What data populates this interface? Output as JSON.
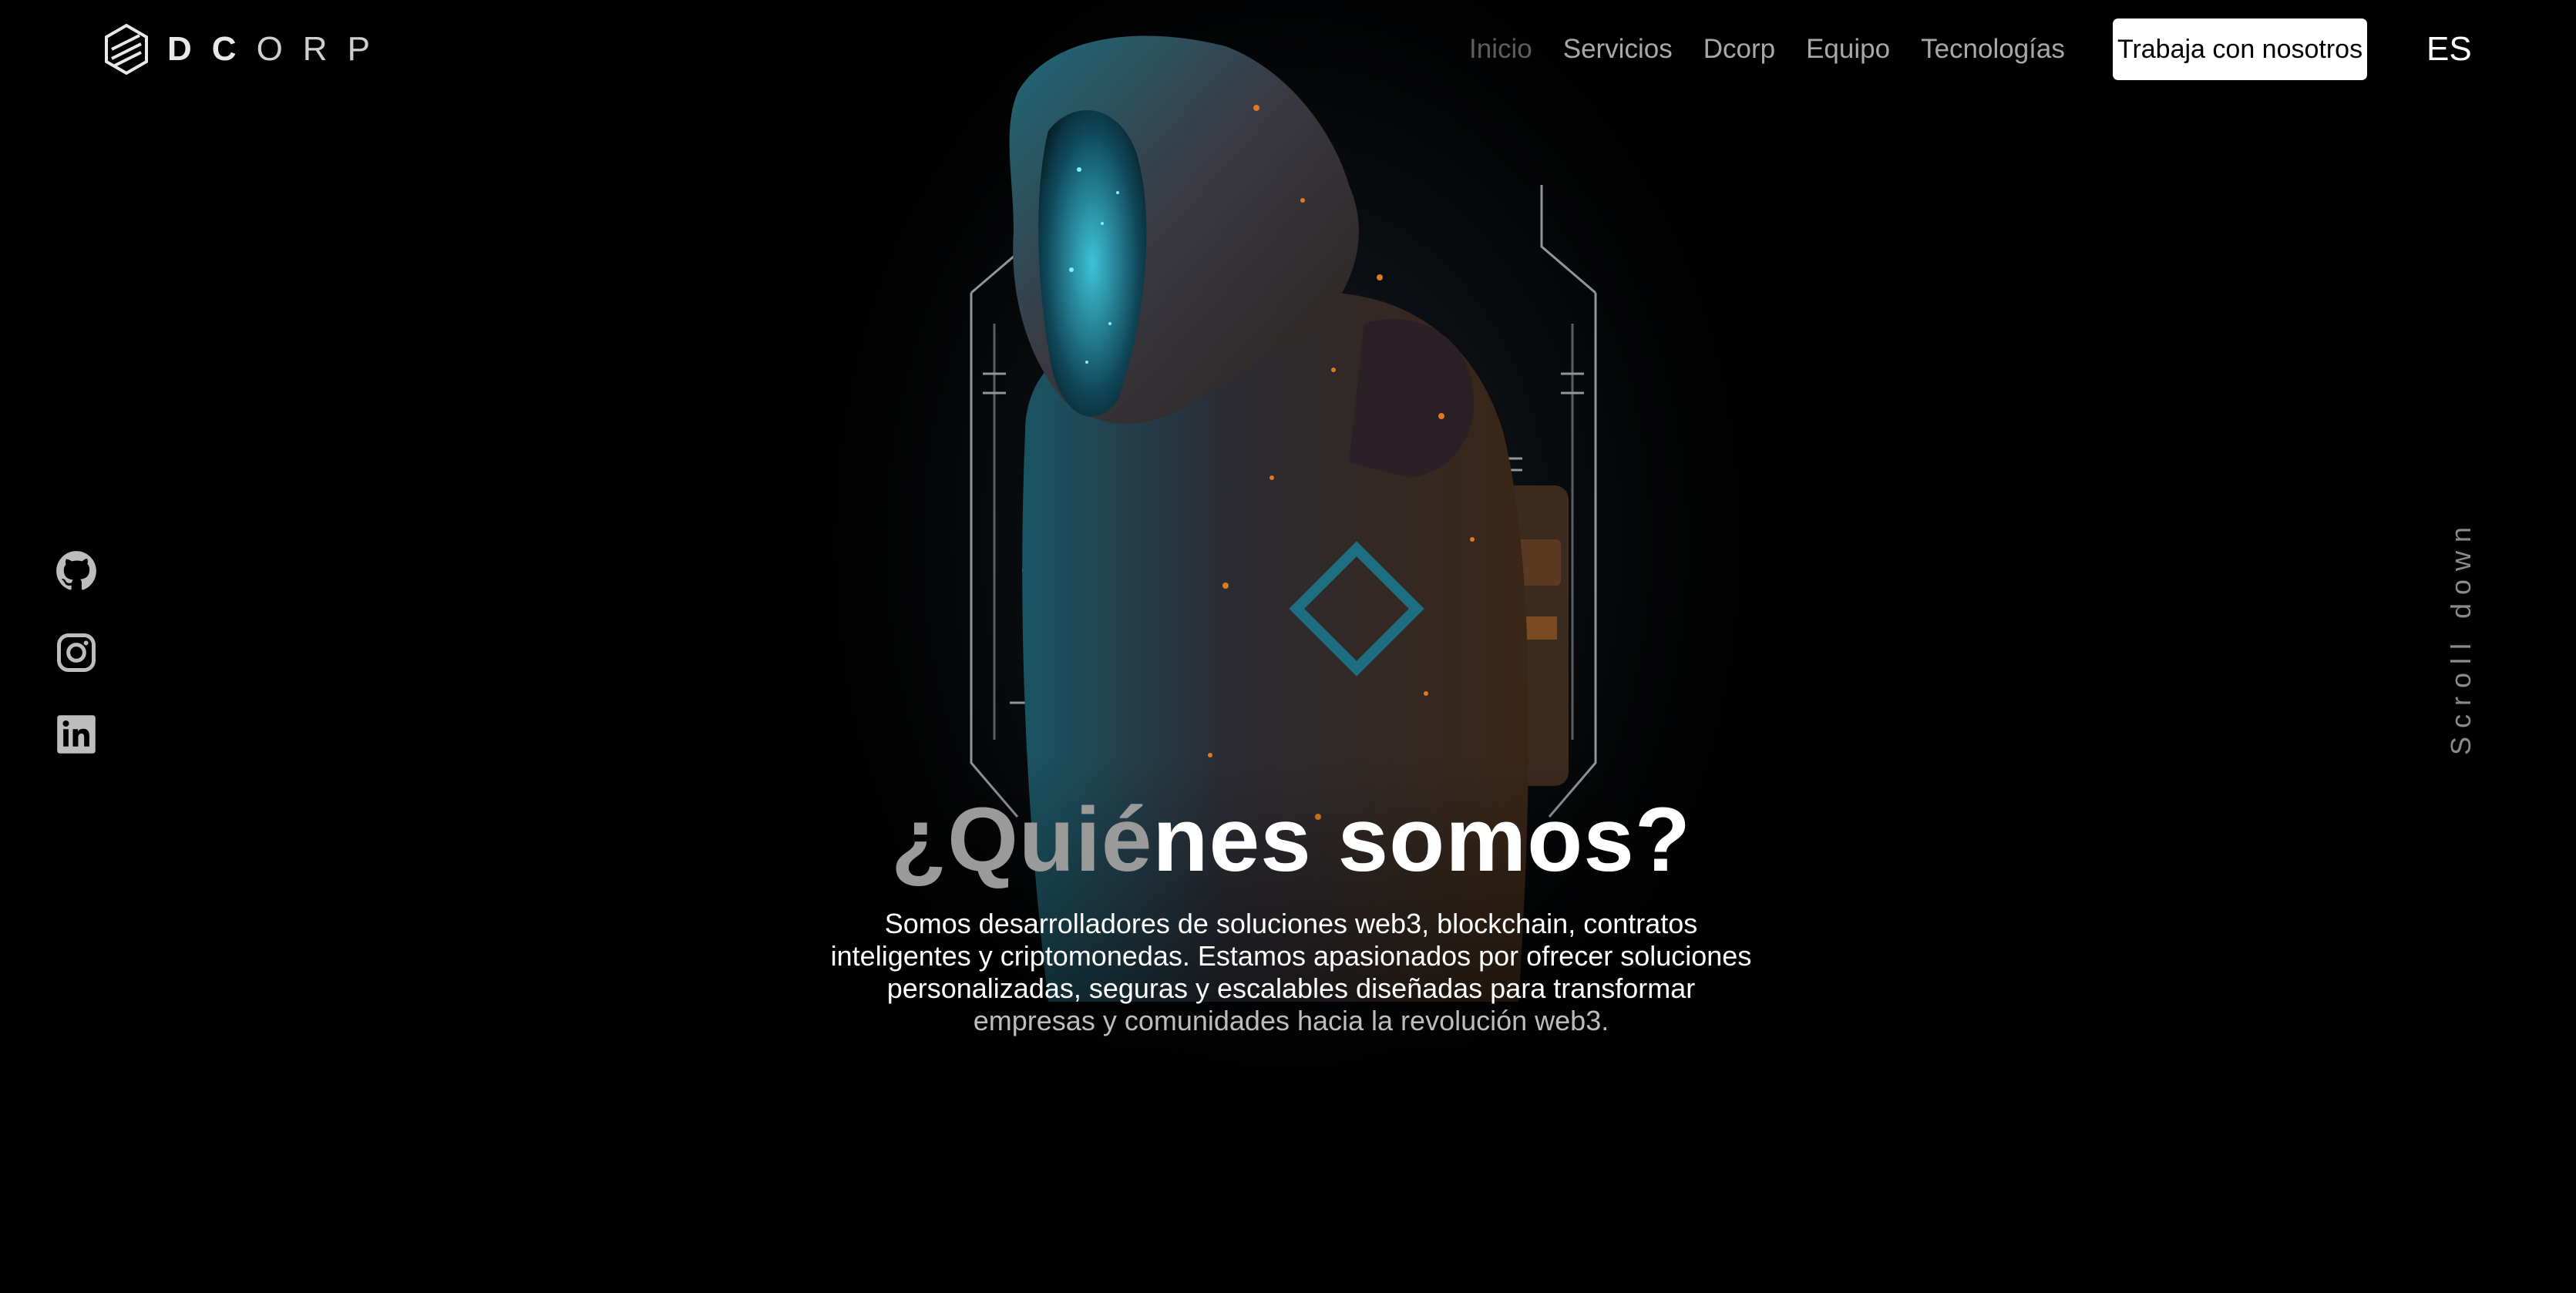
{
  "brand": {
    "logo_text_bold": "DC",
    "logo_text_light": "ORP"
  },
  "nav": {
    "items": [
      {
        "label": "Inicio",
        "active": true
      },
      {
        "label": "Servicios",
        "active": false
      },
      {
        "label": "Dcorp",
        "active": false
      },
      {
        "label": "Equipo",
        "active": false
      },
      {
        "label": "Tecnologías",
        "active": false
      }
    ],
    "cta_label": "Trabaja con nosotros",
    "language": "ES"
  },
  "social": [
    {
      "icon": "github-icon"
    },
    {
      "icon": "instagram-icon"
    },
    {
      "icon": "linkedin-icon"
    }
  ],
  "hero": {
    "title_part1": "¿Quié",
    "title_part2": "nes somos?",
    "description_main": "Somos desarrolladores de soluciones web3, blockchain, contratos inteligentes y criptomonedas. Estamos apasionados por ofrecer soluciones personalizadas, seguras y escalables diseñadas para transformar",
    "description_tail": "empresas y comunidades hacia la revolución web3."
  },
  "scroll_label": "Scroll down",
  "colors": {
    "background": "#000000",
    "nav_text": "#a8a8a8",
    "nav_active": "#5d5d5d",
    "accent_cyan": "#27c4d8",
    "accent_orange": "#d9731f"
  }
}
